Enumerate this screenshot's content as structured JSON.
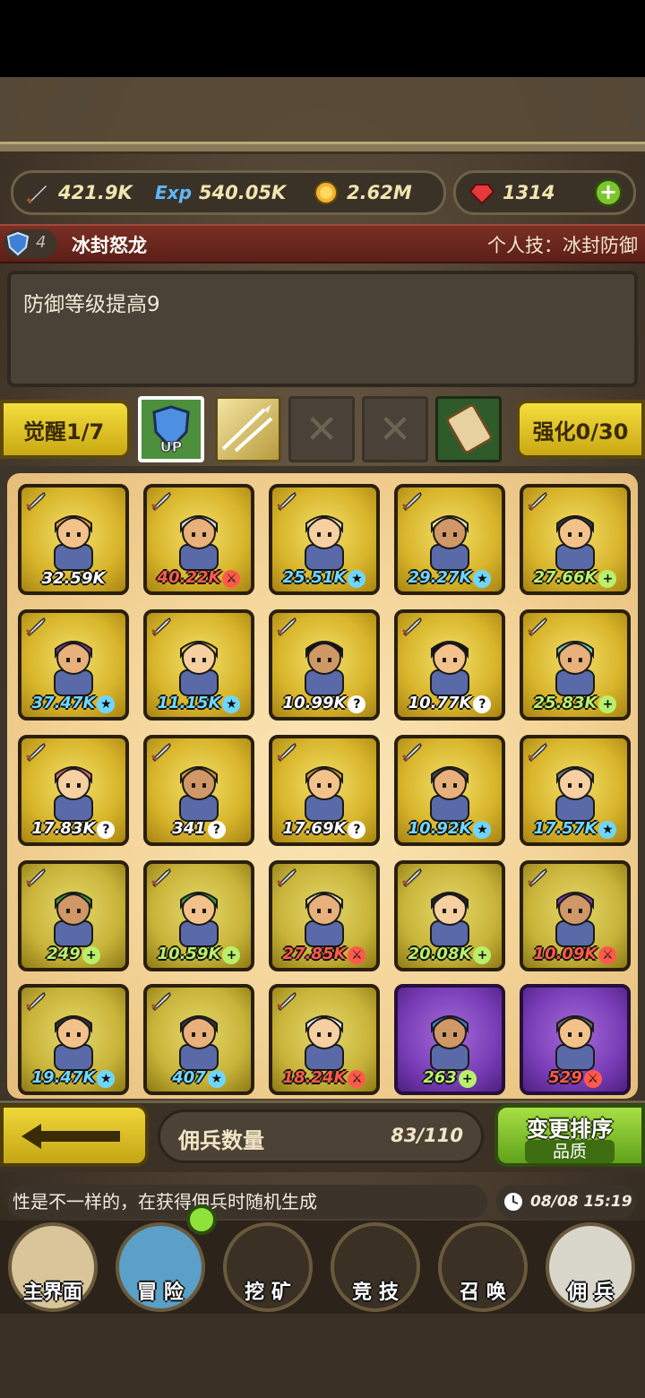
{
  "resources": {
    "attack": "421.9K",
    "exp": "540.05K",
    "gold": "2.62M",
    "gems": "1314"
  },
  "hero": {
    "level": "4",
    "name": "冰封怒龙",
    "personal_skill": "个人技：冰封防御",
    "description": "防御等级提高9"
  },
  "actions": {
    "awaken": "觉醒1/7",
    "enhance": "强化0/30"
  },
  "mercenaries": [
    {
      "stat": "32.59K",
      "color": "#ffffff",
      "badge": "",
      "tier": "gold"
    },
    {
      "stat": "40.22K",
      "color": "#ff5a4a",
      "badge": "sword",
      "tier": "gold"
    },
    {
      "stat": "25.51K",
      "color": "#6fd7ff",
      "badge": "star",
      "tier": "gold"
    },
    {
      "stat": "29.27K",
      "color": "#6fd7ff",
      "badge": "star",
      "tier": "gold"
    },
    {
      "stat": "27.66K",
      "color": "#b9f06b",
      "badge": "plus",
      "tier": "gold"
    },
    {
      "stat": "37.47K",
      "color": "#6fd7ff",
      "badge": "star",
      "tier": "gold"
    },
    {
      "stat": "11.15K",
      "color": "#6fd7ff",
      "badge": "star",
      "tier": "gold"
    },
    {
      "stat": "10.99K",
      "color": "#ffffff",
      "badge": "question",
      "tier": "gold"
    },
    {
      "stat": "10.77K",
      "color": "#ffffff",
      "badge": "question",
      "tier": "gold"
    },
    {
      "stat": "25.83K",
      "color": "#b9f06b",
      "badge": "plus",
      "tier": "gold"
    },
    {
      "stat": "17.83K",
      "color": "#ffffff",
      "badge": "question",
      "tier": "gold"
    },
    {
      "stat": "341",
      "color": "#ffffff",
      "badge": "question",
      "tier": "gold"
    },
    {
      "stat": "17.69K",
      "color": "#ffffff",
      "badge": "question",
      "tier": "gold"
    },
    {
      "stat": "10.92K",
      "color": "#6fd7ff",
      "badge": "star",
      "tier": "gold"
    },
    {
      "stat": "17.57K",
      "color": "#6fd7ff",
      "badge": "star",
      "tier": "gold"
    },
    {
      "stat": "249",
      "color": "#b9f06b",
      "badge": "plus",
      "tier": "olive"
    },
    {
      "stat": "10.59K",
      "color": "#b9f06b",
      "badge": "plus",
      "tier": "olive"
    },
    {
      "stat": "27.85K",
      "color": "#ff5a4a",
      "badge": "sword",
      "tier": "olive"
    },
    {
      "stat": "20.08K",
      "color": "#b9f06b",
      "badge": "plus",
      "tier": "olive"
    },
    {
      "stat": "10.09K",
      "color": "#ff5a4a",
      "badge": "sword",
      "tier": "olive"
    },
    {
      "stat": "19.47K",
      "color": "#6fd7ff",
      "badge": "star",
      "tier": "olive"
    },
    {
      "stat": "407",
      "color": "#6fd7ff",
      "badge": "star",
      "tier": "olive"
    },
    {
      "stat": "18.24K",
      "color": "#ff5a4a",
      "badge": "sword",
      "tier": "olive"
    },
    {
      "stat": "263",
      "color": "#b9f06b",
      "badge": "plus",
      "tier": "purple"
    },
    {
      "stat": "529",
      "color": "#ff5a4a",
      "badge": "sword",
      "tier": "purple"
    }
  ],
  "footer": {
    "count_label": "佣兵数量",
    "count_value": "83/110",
    "sort_label": "变更排序",
    "sort_sub": "品质"
  },
  "ticker": {
    "text": "性是不一样的，在获得佣兵时随机生成",
    "time": "08/08 15:19"
  },
  "nav": [
    {
      "label": "主界面"
    },
    {
      "label": "冒 险"
    },
    {
      "label": "挖 矿"
    },
    {
      "label": "竞 技"
    },
    {
      "label": "召 唤"
    },
    {
      "label": "佣 兵"
    }
  ]
}
